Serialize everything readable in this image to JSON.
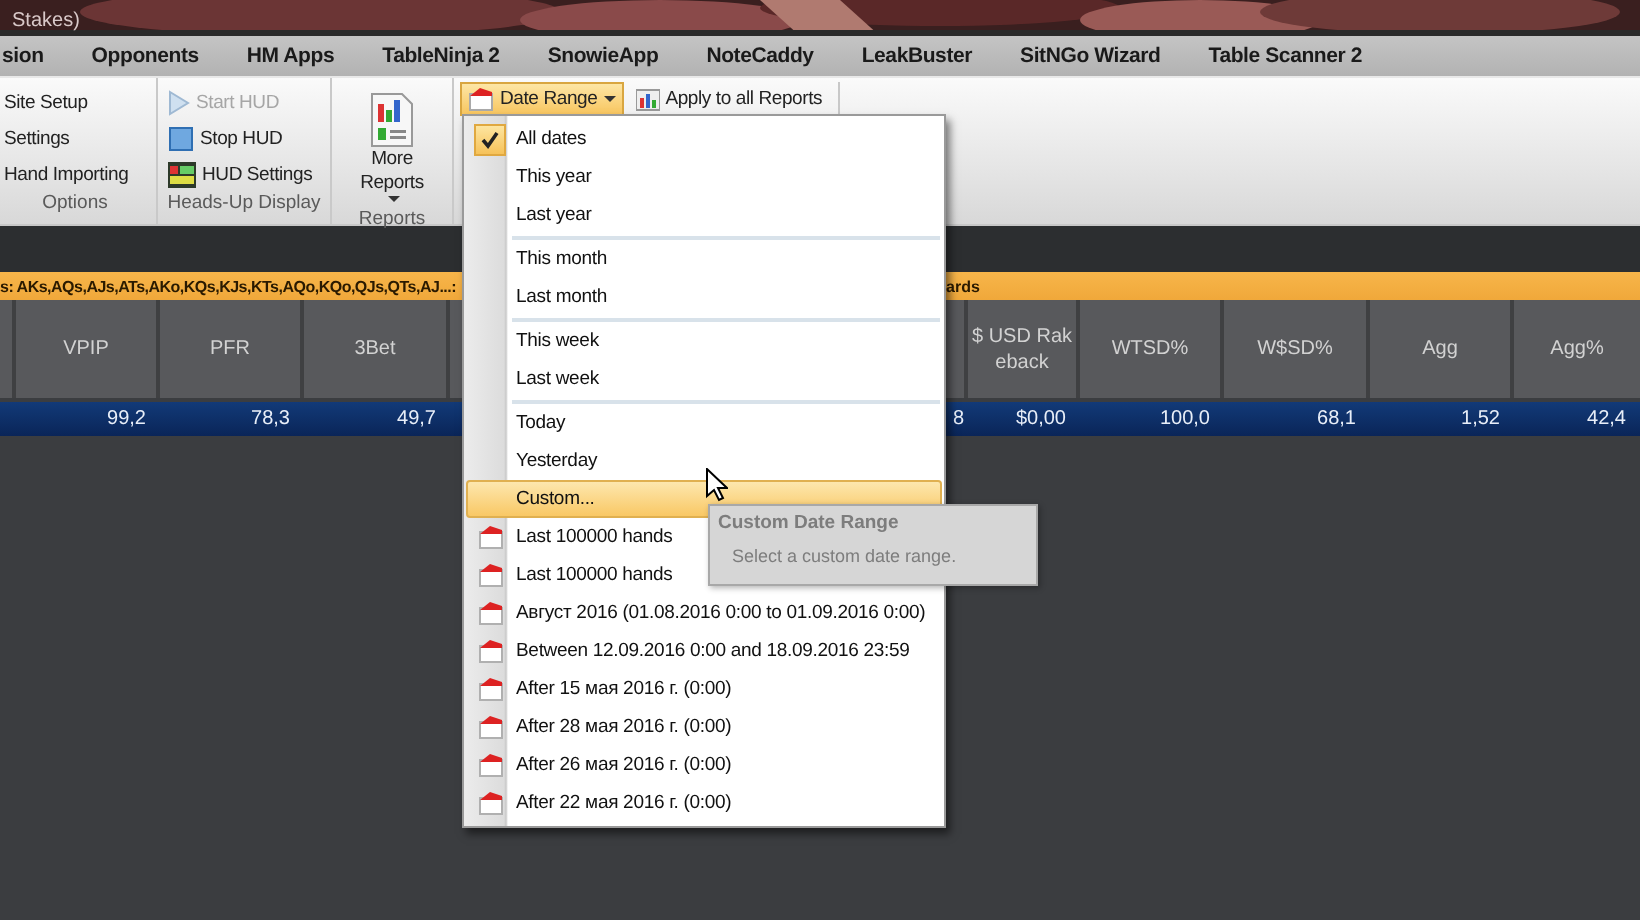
{
  "window": {
    "title": "Stakes)"
  },
  "menu_bar": [
    {
      "label": "sion"
    },
    {
      "label": "Opponents"
    },
    {
      "label": "HM Apps"
    },
    {
      "label": "TableNinja 2"
    },
    {
      "label": "SnowieApp"
    },
    {
      "label": "NoteCaddy"
    },
    {
      "label": "LeakBuster"
    },
    {
      "label": "SitNGo Wizard"
    },
    {
      "label": "Table Scanner 2"
    }
  ],
  "ribbon": {
    "groups": [
      {
        "label": "Options",
        "items": [
          {
            "kind": "plain",
            "label": "Site Setup",
            "disabled": false
          },
          {
            "kind": "plain",
            "label": "Settings",
            "disabled": false
          },
          {
            "kind": "plain",
            "label": "Hand Importing",
            "disabled": false
          }
        ]
      },
      {
        "label": "Heads-Up Display",
        "items": [
          {
            "kind": "play",
            "label": "Start HUD",
            "disabled": true
          },
          {
            "kind": "stop",
            "label": "Stop HUD",
            "disabled": false
          },
          {
            "kind": "hud",
            "label": "HUD Settings",
            "disabled": false
          }
        ]
      },
      {
        "label": "Reports",
        "items": [
          {
            "kind": "big",
            "label": "More Reports",
            "disabled": false
          }
        ]
      }
    ]
  },
  "toolbar": {
    "date_range": {
      "label": "Date Range",
      "open": true
    },
    "apply": {
      "label": "Apply to all Reports"
    }
  },
  "filter_bar": {
    "text": "s: AKs,AQs,AJs,ATs,AKo,KQs,KJs,KTs,AQo,KQo,QJs,QTs,AJ...:",
    "text_2": "ards"
  },
  "table": {
    "columns": [
      {
        "label": "VPIP"
      },
      {
        "label": "PFR"
      },
      {
        "label": "3Bet"
      },
      {},
      {
        "label": "$ USD Rakeback"
      },
      {
        "label": "WTSD%"
      },
      {
        "label": "W$SD%"
      },
      {
        "label": "Agg"
      },
      {
        "label": "Agg%"
      }
    ],
    "rows": [
      {
        "selected": true,
        "cells": [
          "99,2",
          "78,3",
          "49,7",
          "8",
          "$0,00",
          "100,0",
          "68,1",
          "1,52",
          "42,4"
        ]
      }
    ]
  },
  "date_menu": {
    "items": [
      {
        "kind": "preset",
        "label": "All dates",
        "checked": true,
        "selected": false
      },
      {
        "kind": "preset",
        "label": "This year",
        "checked": false,
        "selected": false
      },
      {
        "kind": "preset",
        "label": "Last year",
        "checked": false,
        "selected": false
      },
      {
        "kind": "separator"
      },
      {
        "kind": "preset",
        "label": "This month",
        "checked": false,
        "selected": false
      },
      {
        "kind": "preset",
        "label": "Last month",
        "checked": false,
        "selected": false
      },
      {
        "kind": "separator"
      },
      {
        "kind": "preset",
        "label": "This week",
        "checked": false,
        "selected": false
      },
      {
        "kind": "preset",
        "label": "Last week",
        "checked": false,
        "selected": false
      },
      {
        "kind": "separator"
      },
      {
        "kind": "preset",
        "label": "Today",
        "checked": false,
        "selected": false
      },
      {
        "kind": "preset",
        "label": "Yesterday",
        "checked": false,
        "selected": false
      },
      {
        "kind": "preset",
        "label": "Custom...",
        "checked": false,
        "selected": true
      },
      {
        "kind": "saved",
        "label": "Last 100000 hands",
        "checked": false,
        "selected": false
      },
      {
        "kind": "saved",
        "label": "Last 100000 hands",
        "checked": false,
        "selected": false
      },
      {
        "kind": "saved",
        "label": "Август 2016 (01.08.2016 0:00 to 01.09.2016 0:00)",
        "checked": false,
        "selected": false
      },
      {
        "kind": "saved",
        "label": "Between 12.09.2016 0:00 and 18.09.2016 23:59",
        "checked": false,
        "selected": false
      },
      {
        "kind": "saved",
        "label": "After 15 мая 2016 г. (0:00)",
        "checked": false,
        "selected": false
      },
      {
        "kind": "saved",
        "label": "After 28 мая 2016 г. (0:00)",
        "checked": false,
        "selected": false
      },
      {
        "kind": "saved",
        "label": "After 26 мая 2016 г. (0:00)",
        "checked": false,
        "selected": false
      },
      {
        "kind": "saved",
        "label": "After 22 мая 2016 г. (0:00)",
        "checked": false,
        "selected": false
      }
    ]
  },
  "tooltip": {
    "title": "Custom Date Range",
    "text": "Select a custom date range."
  }
}
